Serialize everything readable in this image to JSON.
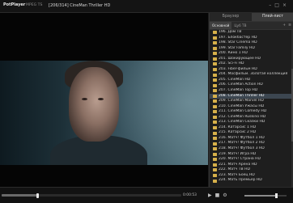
{
  "titlebar": {
    "app_logo": "PotPlayer",
    "format": "MPEG TS",
    "info": "[206/314] CineMan Thriller HD"
  },
  "panel": {
    "tabs": [
      {
        "label": "Браузер",
        "active": false
      },
      {
        "label": "Плей-лист",
        "active": true
      }
    ],
    "subtabs": [
      {
        "label": "Основной",
        "active": true
      },
      {
        "label": "Цуб ТВ",
        "active": false
      }
    ],
    "buttons": [
      "+",
      "≡"
    ],
    "items": [
      {
        "label": "196. Дом ТВ"
      },
      {
        "label": "197. Блокбастер HD"
      },
      {
        "label": "198. Star Cinema HD"
      },
      {
        "label": "199. Star Family HD"
      },
      {
        "label": "200. Кино 1 HD"
      },
      {
        "label": "201. Шокирующее HD"
      },
      {
        "label": "202. Sci-Fi HD"
      },
      {
        "label": "203. Fiber-фильм HD"
      },
      {
        "label": "204. Мосфильм. Золотая коллекция"
      },
      {
        "label": "205. CineMan HD"
      },
      {
        "label": "206. CineMan Action HD"
      },
      {
        "label": "207. CineMan Top HD"
      },
      {
        "label": "208. CineMan Thriller HD",
        "selected": true
      },
      {
        "label": "209. CineMan Marvel HD"
      },
      {
        "label": "210. CineMan Ужасы HD"
      },
      {
        "label": "211. CineMan Comedy HD"
      },
      {
        "label": "212. CineMan Ruskino HD"
      },
      {
        "label": "213. CineMan Сказки HD"
      },
      {
        "label": "214. Катарсис 1 HD"
      },
      {
        "label": "215. Катарсис 2 HD"
      },
      {
        "label": "216. Матч! Футбол 1 HD"
      },
      {
        "label": "217. Матч! Футбол 2 HD"
      },
      {
        "label": "218. Матч! Футбол 3 HD"
      },
      {
        "label": "219. Матч! Игра HD"
      },
      {
        "label": "220. Матч! Страна HD"
      },
      {
        "label": "221. Матч Арена HD"
      },
      {
        "label": "222. Матч ТВ HD"
      },
      {
        "label": "223. Матч Боец HD"
      },
      {
        "label": "224. Мать Премьер HD"
      }
    ],
    "scroll_fraction": 0.46
  },
  "controls": {
    "time": "0:00:53",
    "seek_fraction": 0.2,
    "volume_fraction": 0.75,
    "icons": [
      "play-icon",
      "stop-icon",
      "settings-icon"
    ]
  },
  "colors": {
    "accent": "#d6b04a",
    "selection": "#3c4650"
  }
}
